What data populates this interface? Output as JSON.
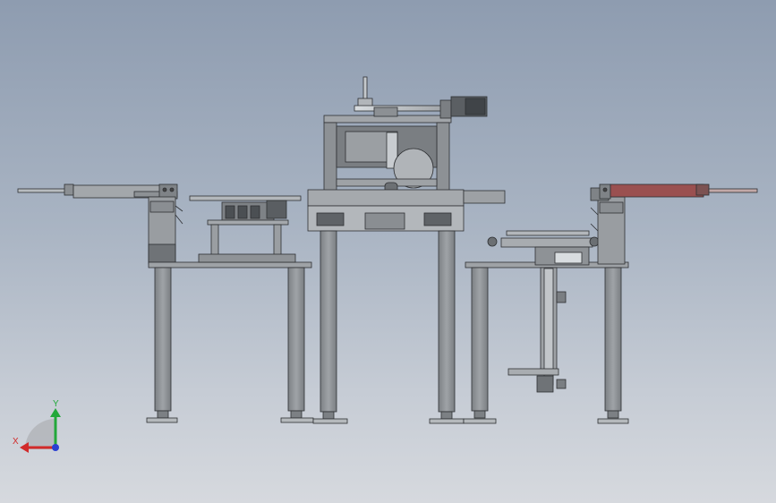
{
  "viewport": {
    "background_top": "#8e9cb0",
    "background_bottom": "#d6d9de"
  },
  "triad": {
    "x_label": "X",
    "y_label": "Y",
    "x_color": "#d12a2a",
    "y_color": "#22a83a",
    "z_color": "#2a3fd1"
  },
  "model": {
    "machine_color": "#8f9397",
    "accent_color": "#9a5050",
    "edge_color": "#2e3033"
  }
}
